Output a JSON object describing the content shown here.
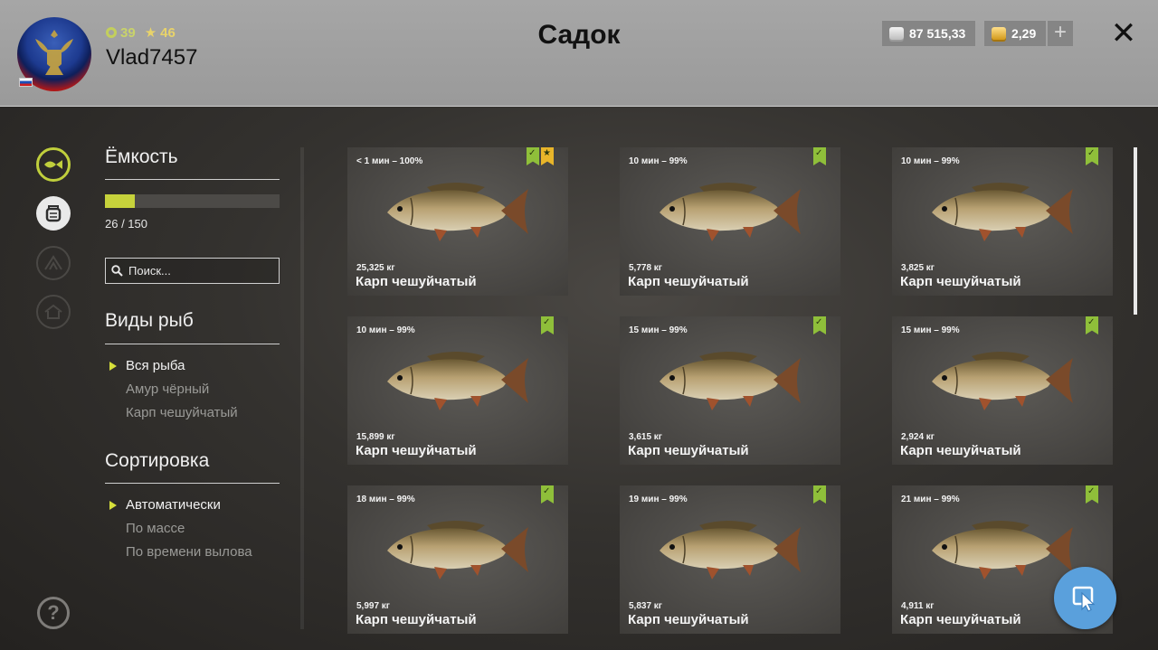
{
  "header": {
    "title": "Садок",
    "username": "Vlad7457",
    "level": "39",
    "rank": "46",
    "silver": "87 515,33",
    "gold": "2,29",
    "plus": "+",
    "close": "✕"
  },
  "sidebar": {
    "capacity_title": "Ёмкость",
    "capacity_text": "26 / 150",
    "capacity_fraction": 0.173,
    "search_placeholder": "Поиск...",
    "species_title": "Виды рыб",
    "species": [
      "Вся рыба",
      "Амур чёрный",
      "Карп чешуйчатый"
    ],
    "sort_title": "Сортировка",
    "sort_options": [
      "Автоматически",
      "По массе",
      "По времени вылова"
    ],
    "help": "?"
  },
  "fish_cards": [
    {
      "time": "< 1 мин – 100%",
      "weight": "25,325 кг",
      "name": "Карп чешуйчатый",
      "trophy": true
    },
    {
      "time": "10 мин – 99%",
      "weight": "5,778 кг",
      "name": "Карп чешуйчатый",
      "trophy": false
    },
    {
      "time": "10 мин – 99%",
      "weight": "3,825 кг",
      "name": "Карп чешуйчатый",
      "trophy": false
    },
    {
      "time": "10 мин – 99%",
      "weight": "15,899 кг",
      "name": "Карп чешуйчатый",
      "trophy": false
    },
    {
      "time": "15 мин – 99%",
      "weight": "3,615 кг",
      "name": "Карп чешуйчатый",
      "trophy": false
    },
    {
      "time": "15 мин – 99%",
      "weight": "2,924 кг",
      "name": "Карп чешуйчатый",
      "trophy": false
    },
    {
      "time": "18 мин – 99%",
      "weight": "5,997 кг",
      "name": "Карп чешуйчатый",
      "trophy": false
    },
    {
      "time": "19 мин – 99%",
      "weight": "5,837 кг",
      "name": "Карп чешуйчатый",
      "trophy": false
    },
    {
      "time": "21 мин – 99%",
      "weight": "4,911 кг",
      "name": "Карп чешуйчатый",
      "trophy": false
    }
  ],
  "colors": {
    "accent": "#c6d23b",
    "badge_green": "#8fbf3a",
    "badge_gold": "#e8b52a",
    "cursor_button": "#5aa0dc"
  }
}
